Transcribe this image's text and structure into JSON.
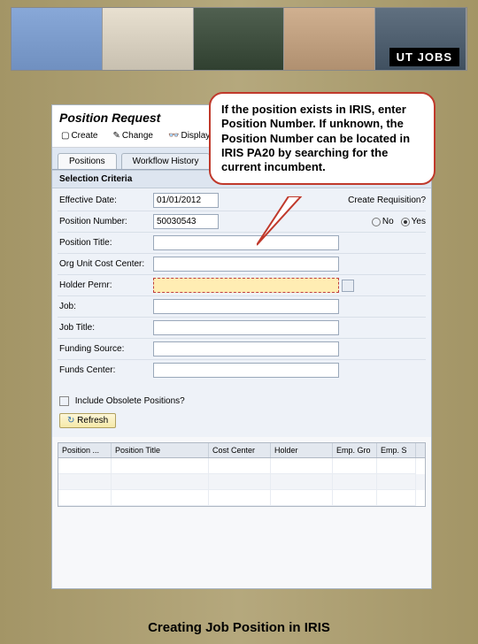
{
  "banner": {
    "logo_text": "UT JOBS"
  },
  "app": {
    "title": "Position Request",
    "toolbar": {
      "create": "Create",
      "change": "Change",
      "display": "Display"
    },
    "tabs": {
      "positions": "Positions",
      "workflow": "Workflow History"
    },
    "section_header": "Selection Criteria",
    "fields": {
      "effective_date": {
        "label": "Effective Date:",
        "value": "01/01/2012"
      },
      "position_number": {
        "label": "Position Number:",
        "value": "50030543"
      },
      "position_title": {
        "label": "Position Title:",
        "value": ""
      },
      "org_cost_center": {
        "label": "Org Unit Cost Center:",
        "value": ""
      },
      "holder_pernr": {
        "label": "Holder Pernr:",
        "value": ""
      },
      "job": {
        "label": "Job:",
        "value": ""
      },
      "job_title": {
        "label": "Job Title:",
        "value": ""
      },
      "funding_source": {
        "label": "Funding Source:",
        "value": ""
      },
      "funds_center": {
        "label": "Funds Center:",
        "value": ""
      }
    },
    "create_requisition": {
      "label": "Create Requisition?",
      "no": "No",
      "yes": "Yes"
    },
    "obsolete_label": "Include Obsolete Positions?",
    "refresh_label": "Refresh",
    "grid_headers": {
      "position": "Position ...",
      "position_title": "Position Title",
      "cost_center": "Cost Center",
      "holder": "Holder",
      "emp_gro": "Emp. Gro",
      "emp_s": "Emp. S"
    }
  },
  "callout": "If the position exists in IRIS, enter Position Number. If unknown, the Position Number can be located in IRIS PA20 by searching for the current incumbent.",
  "caption": "Creating Job Position in IRIS"
}
